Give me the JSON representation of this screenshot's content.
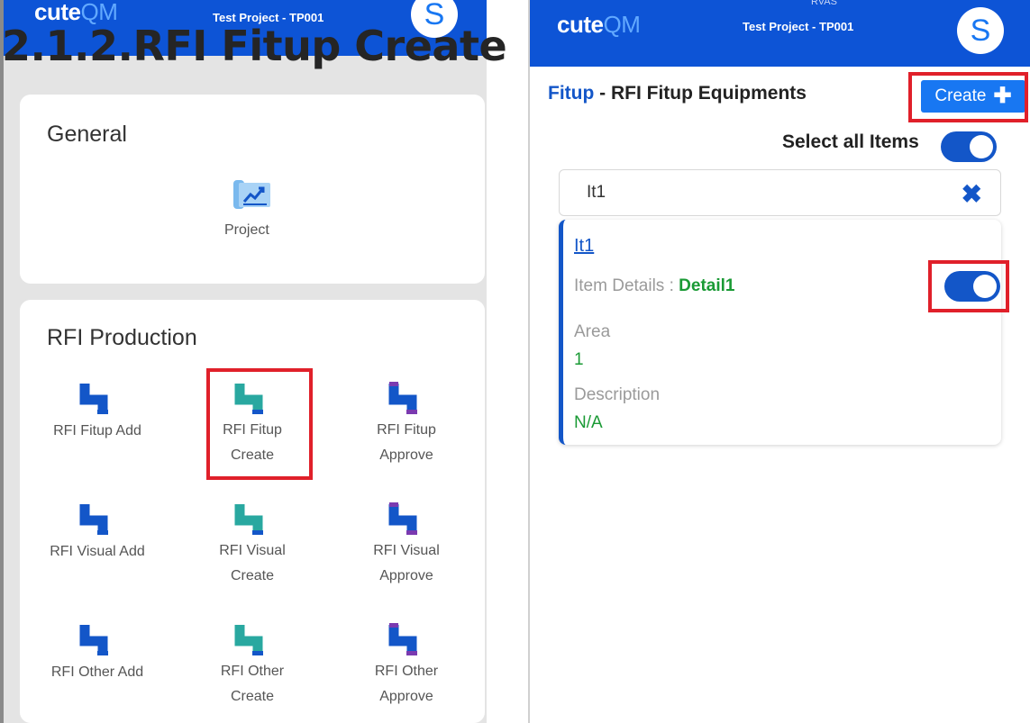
{
  "page_title": "2.1.2.RFI Fitup Create",
  "left_screen": {
    "app": {
      "brand_main": "cute",
      "brand_accent": "QM",
      "project": "Test Project - TP001",
      "avatar_initial": "S"
    },
    "general": {
      "title": "General",
      "items": [
        {
          "label": "Project",
          "icon": "project-chart-icon"
        }
      ]
    },
    "rfi_production": {
      "title": "RFI Production",
      "items": [
        {
          "label": "RFI Fitup Add",
          "icon": "pipe-icon",
          "color": "#1356c8",
          "highlighted": false
        },
        {
          "label": "RFI Fitup Create",
          "icon": "pipe-icon",
          "color": "#29a8a0",
          "highlighted": true
        },
        {
          "label": "RFI Fitup Approve",
          "icon": "pipe-icon",
          "color": "#7a3ab0",
          "highlighted": false
        },
        {
          "label": "RFI Visual Add",
          "icon": "pipe-icon",
          "color": "#1356c8",
          "highlighted": false
        },
        {
          "label": "RFI Visual Create",
          "icon": "pipe-icon",
          "color": "#29a8a0",
          "highlighted": false
        },
        {
          "label": "RFI Visual Approve",
          "icon": "pipe-icon",
          "color": "#7a3ab0",
          "highlighted": false
        },
        {
          "label": "RFI Other Add",
          "icon": "pipe-icon",
          "color": "#1356c8",
          "highlighted": false
        },
        {
          "label": "RFI Other Create",
          "icon": "pipe-icon",
          "color": "#29a8a0",
          "highlighted": false
        },
        {
          "label": "RFI Other Approve",
          "icon": "pipe-icon",
          "color": "#7a3ab0",
          "highlighted": false
        }
      ]
    }
  },
  "right_screen": {
    "app": {
      "brand_main": "cute",
      "brand_accent": "QM",
      "project": "Test Project - TP001",
      "avatar_initial": "S",
      "clipped_top_text": "RVAS"
    },
    "breadcrumb": {
      "module": "Fitup",
      "separator": " - ",
      "page": "RFI Fitup Equipments"
    },
    "create_button": {
      "label": "Create",
      "icon": "plus-icon"
    },
    "select_all": {
      "label": "Select all Items",
      "on": true
    },
    "search": {
      "value": "It1",
      "clear_icon": "close-x-icon"
    },
    "item": {
      "name": "It1",
      "details_label": "Item Details : ",
      "details_value": "Detail1",
      "selected": true,
      "area_label": "Area",
      "area_value": "1",
      "description_label": "Description",
      "description_value": "N/A"
    }
  },
  "colors": {
    "app_bar": "#0d54d6",
    "accent_blue": "#1356c8",
    "button_blue": "#1877f2",
    "value_green": "#1a9a35",
    "highlight_red": "#e0202a"
  }
}
